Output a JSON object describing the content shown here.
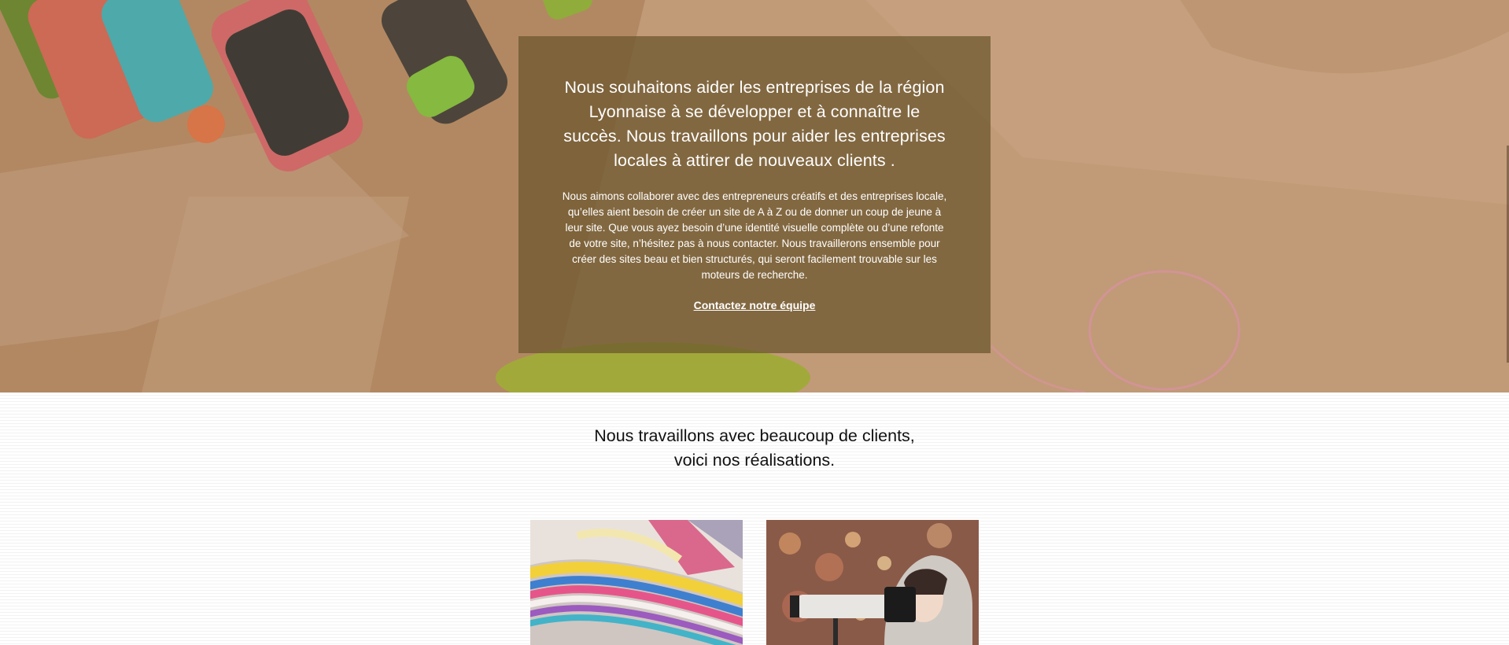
{
  "hero": {
    "heading": "Nous souhaitons aider les entreprises de la région Lyonnaise à se développer et à connaître le succès. Nous travaillons pour aider les entreprises locales à attirer de nouveaux clients .",
    "text": "Nous aimons collaborer avec des entrepreneurs créatifs et des entreprises locale, qu’elles aient besoin de créer un site de A à Z ou de donner un coup de jeune à leur site. Que vous ayez besoin d’une identité visuelle complète ou d’une refonte de votre site, n’hésitez pas à nous contacter. Nous travaillerons ensemble pour créer des sites beau et bien structurés, qui seront facilement trouvable sur les moteurs de recherche.",
    "cta_label": "Contactez notre équipe",
    "background_icon": "highlighter-markers-photo"
  },
  "work": {
    "heading_line1": "Nous travaillons avec beaucoup de clients,",
    "heading_line2": "voici nos réalisations.",
    "projects": [
      {
        "image": "colorful-magazines-photo"
      },
      {
        "image": "photographer-camera-photo"
      }
    ]
  },
  "colors": {
    "hero_overlay_box": "#69552d",
    "text_light": "#ffffff",
    "text_dark": "#111111"
  }
}
